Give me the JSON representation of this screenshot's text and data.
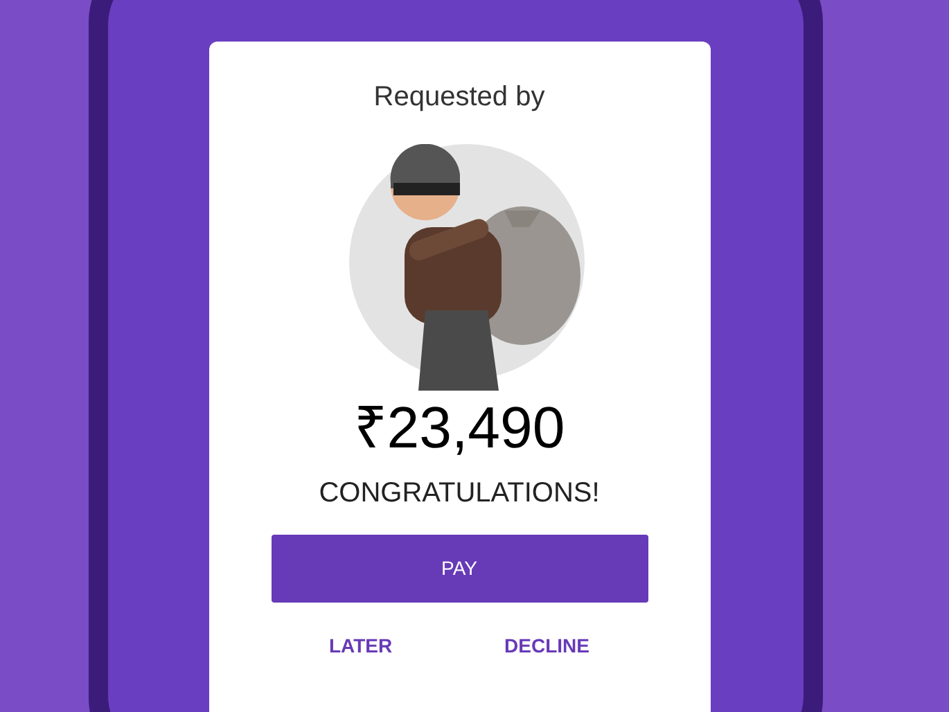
{
  "card": {
    "title": "Requested by",
    "amount": "₹23,490",
    "message": "CONGRATULATIONS!"
  },
  "primary_button": "PAY",
  "secondary_buttons": [
    "LATER",
    "DECLINE"
  ]
}
